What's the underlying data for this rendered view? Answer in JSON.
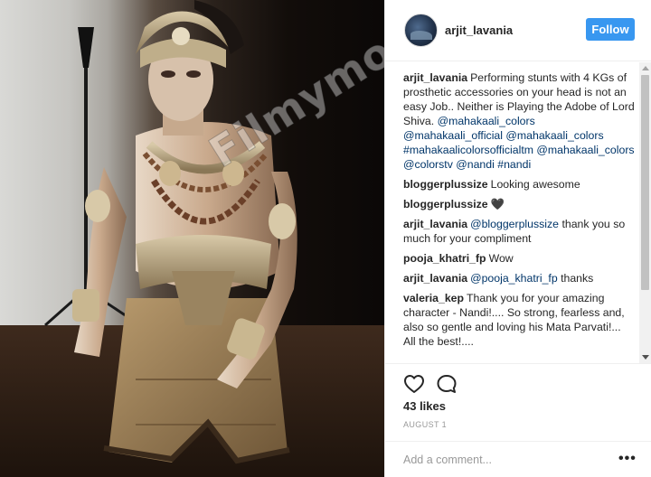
{
  "post": {
    "username": "arjit_lavania",
    "follow_label": "Follow",
    "watermark": "Filmymonkey",
    "comments": [
      {
        "author": "arjit_lavania",
        "segments": [
          {
            "text": "Performing stunts with 4 KGs of prosthetic accessories on your head is not an easy Job.. Neither is Playing the Adobe of Lord Shiva. ",
            "mention": false
          },
          {
            "text": "@mahakaali_colors @mahakaali_official @mahakaali_colors #mahakaalicolorsofficialtm @mahakaali_colors @colorstv @nandi #nandi",
            "mention": true
          }
        ]
      },
      {
        "author": "bloggerplussize",
        "segments": [
          {
            "text": "Looking awesome",
            "mention": false
          }
        ]
      },
      {
        "author": "bloggerplussize",
        "segments": [
          {
            "text": "🖤",
            "mention": false
          }
        ]
      },
      {
        "author": "arjit_lavania",
        "segments": [
          {
            "text": "@bloggerplussize",
            "mention": true
          },
          {
            "text": " thank you so much for your compliment",
            "mention": false
          }
        ]
      },
      {
        "author": "pooja_khatri_fp",
        "segments": [
          {
            "text": "Wow",
            "mention": false
          }
        ]
      },
      {
        "author": "arjit_lavania",
        "segments": [
          {
            "text": "@pooja_khatri_fp",
            "mention": true
          },
          {
            "text": " thanks",
            "mention": false
          }
        ]
      },
      {
        "author": "valeria_kep",
        "segments": [
          {
            "text": "Thank you for your amazing character - Nandi!.... So strong, fearless and, also so gentle and loving his Mata Parvati!... All the best!....",
            "mention": false
          }
        ]
      }
    ],
    "likes": "43 likes",
    "date": "AUGUST 1",
    "add_comment_placeholder": "Add a comment...",
    "more_label": "•••",
    "icons": {
      "like": "heart-outline-icon",
      "comment": "speech-bubble-icon",
      "more": "ellipsis-icon"
    }
  },
  "colors": {
    "follow_button": "#3897f0",
    "mention": "#003569",
    "muted": "#999999"
  }
}
